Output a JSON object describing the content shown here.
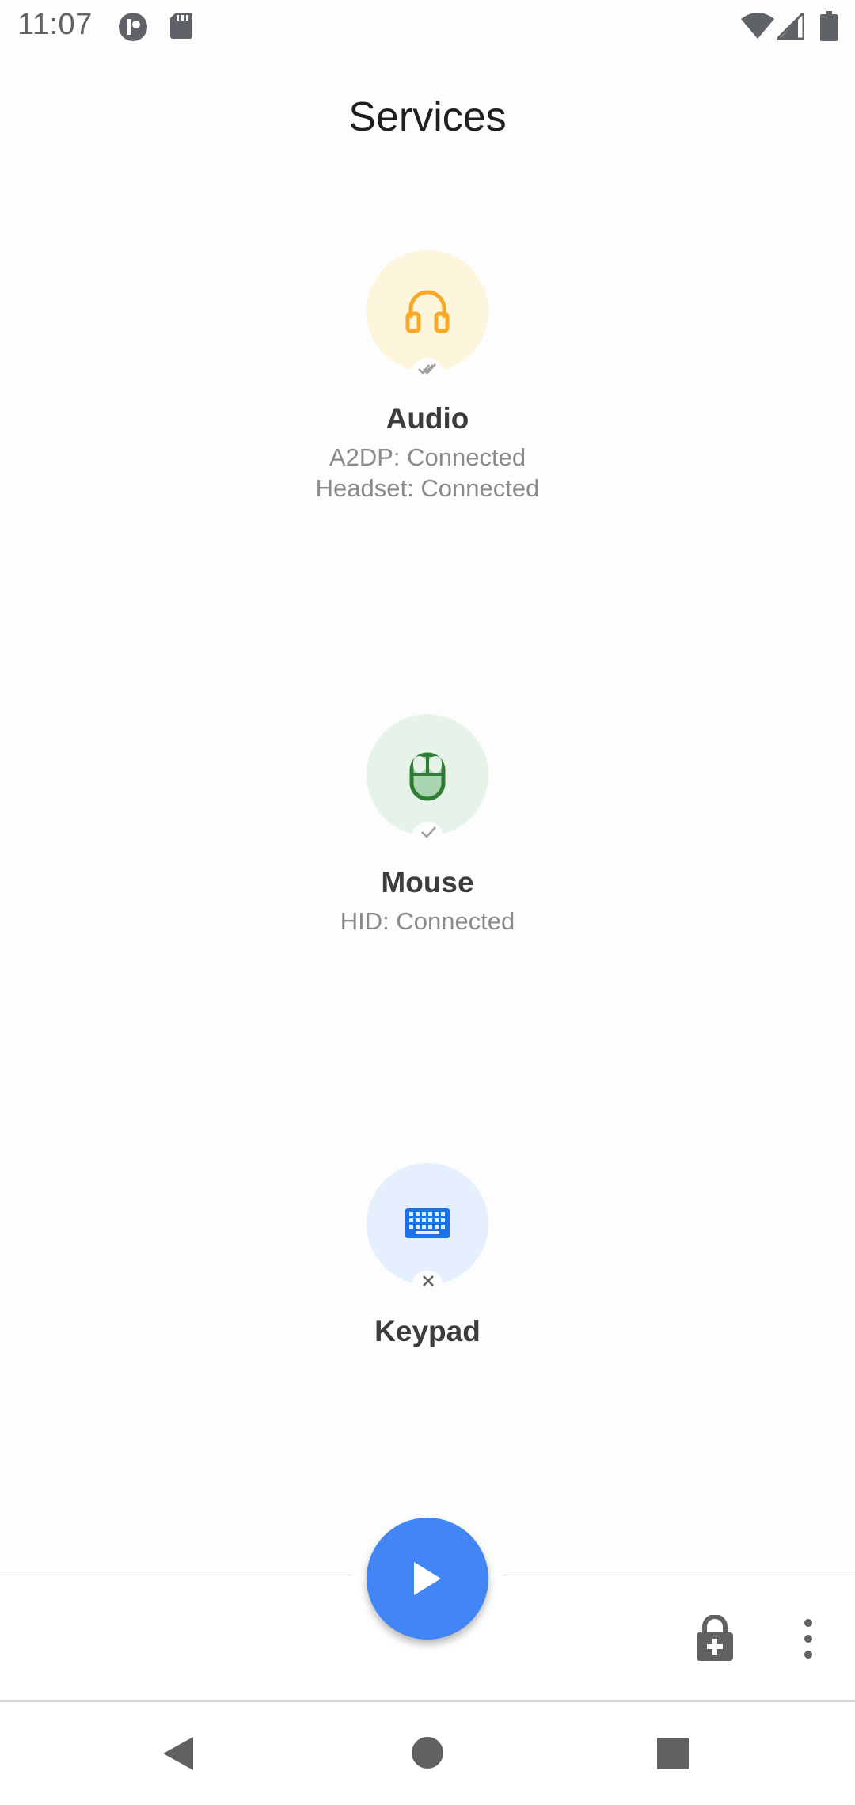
{
  "status_bar": {
    "time": "11:07",
    "left_icons": [
      "app-notification-icon",
      "sd-card-icon"
    ],
    "right_icons": [
      "wifi-icon",
      "cellular-signal-icon",
      "battery-icon"
    ]
  },
  "page": {
    "title": "Services"
  },
  "services": [
    {
      "name": "Audio",
      "icon": "headset-icon",
      "status_icon": "double-check-icon",
      "lines": [
        "A2DP: Connected",
        "Headset: Connected"
      ],
      "accent": "#f9a825",
      "bg": "#fdf5dc"
    },
    {
      "name": "Mouse",
      "icon": "mouse-icon",
      "status_icon": "check-icon",
      "lines": [
        "HID: Connected"
      ],
      "accent": "#2e7d32",
      "bg": "#e6f3e8"
    },
    {
      "name": "Keypad",
      "icon": "keyboard-icon",
      "status_icon": "close-icon",
      "lines": [],
      "accent": "#1a73e8",
      "bg": "#e6effd"
    }
  ],
  "bottom_bar": {
    "fab_icon": "play-icon",
    "fab_color": "#4285f4",
    "actions": [
      "lock-add-icon",
      "more-vert-icon"
    ]
  },
  "nav_bar": {
    "buttons": [
      "back-icon",
      "home-icon",
      "recents-icon"
    ]
  }
}
